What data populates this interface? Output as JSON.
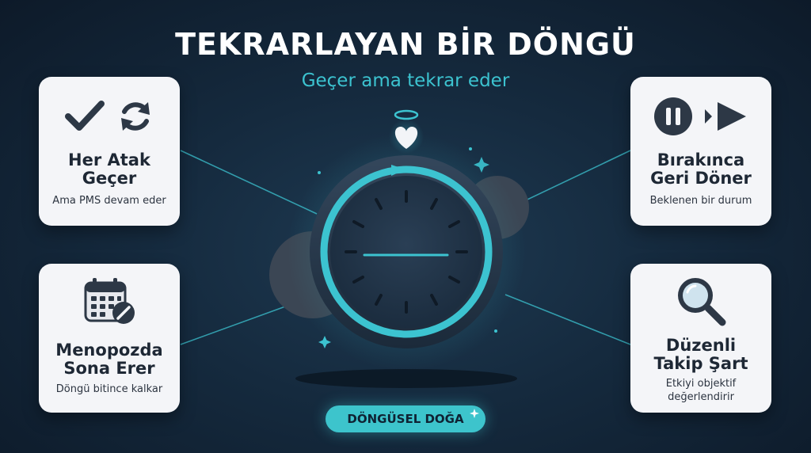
{
  "header": {
    "title": "TEKRARLAYAN BİR DÖNGÜ",
    "subtitle": "Geçer ama tekrar eder"
  },
  "cards": [
    {
      "title_line1": "Her Atak",
      "title_line2": "Geçer",
      "subtitle_line1": "Ama PMS devam eder",
      "icons": [
        "checkmark-icon",
        "refresh-cycle-icon"
      ]
    },
    {
      "title_line1": "Menopozda",
      "title_line2": "Sona Erer",
      "subtitle_line1": "Döngü bitince kalkar",
      "icons": [
        "calendar-blocked-icon"
      ]
    },
    {
      "title_line1": "Bırakınca",
      "title_line2": "Geri Döner",
      "subtitle_line1": "Beklenen bir durum",
      "icons": [
        "pause-icon",
        "play-icon"
      ]
    },
    {
      "title_line1": "Düzenli",
      "title_line2": "Takip Şart",
      "subtitle_line1": "Etkiyi objektif",
      "subtitle_line2": "değerlendirir",
      "icons": [
        "magnifier-icon"
      ]
    }
  ],
  "center": {
    "icons": [
      "heart-halo-icon",
      "cyclic-clock-icon"
    ]
  },
  "badge": {
    "label": "DÖNGÜSEL DOĞA"
  },
  "colors": {
    "background": "#152a3e",
    "accent": "#3cc3d0",
    "card": "#f4f5f8",
    "text_dark": "#1e2835"
  }
}
